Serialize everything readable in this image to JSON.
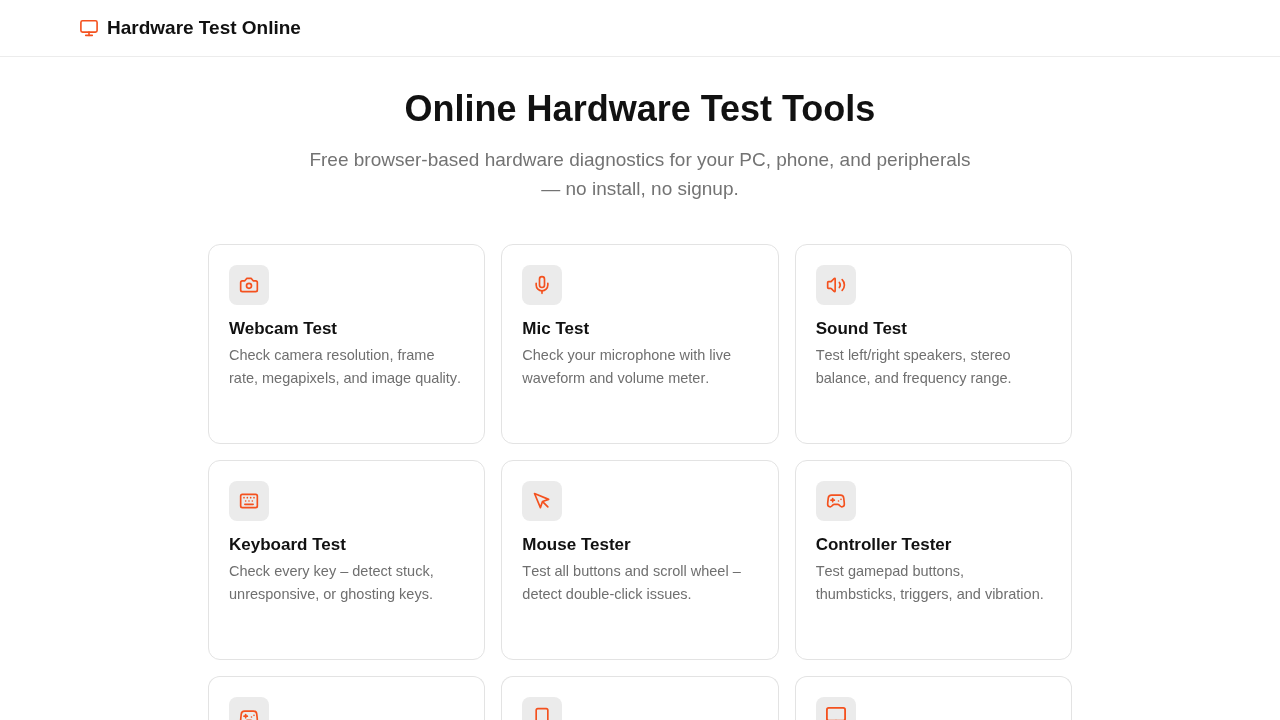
{
  "header": {
    "title": "Hardware Test Online"
  },
  "hero": {
    "title": "Online Hardware Test Tools",
    "subtitle": "Free browser-based hardware diagnostics for your PC, phone, and peripherals — no install, no signup."
  },
  "cards": [
    {
      "kind": "tool",
      "title": "Webcam Test",
      "description": "Check camera resolution, frame rate, megapixels, and image quality."
    },
    {
      "kind": "tool",
      "title": "Mic Test",
      "description": "Check your microphone with live waveform and volume meter."
    },
    {
      "kind": "tool",
      "title": "Sound Test",
      "description": "Test left/right speakers, stereo balance, and frequency range."
    },
    {
      "kind": "tool",
      "title": "Keyboard Test",
      "description": "Check every key – detect stuck, unresponsive, or ghosting keys."
    },
    {
      "kind": "tool",
      "title": "Mouse Tester",
      "description": "Test all buttons and scroll wheel – detect double-click issues."
    },
    {
      "kind": "tool",
      "title": "Controller Tester",
      "description": "Test gamepad buttons, thumbsticks, triggers, and vibration."
    },
    {
      "kind": "partial"
    },
    {
      "kind": "partial"
    },
    {
      "kind": "partial"
    }
  ]
}
